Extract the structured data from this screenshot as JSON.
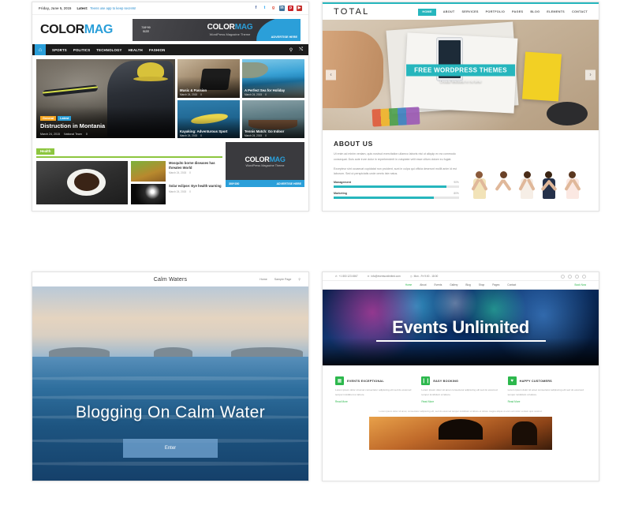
{
  "page": {
    "background": "#ffffff",
    "layout": "2x2 grid of WordPress theme preview thumbnails"
  },
  "colormag": {
    "topbar": {
      "date": "Friday, June 5, 2015",
      "latest_label": "Latest:",
      "latest_text": "Teens use app to keep secrets!",
      "social": [
        "facebook-icon",
        "twitter-icon",
        "google-plus-icon",
        "linkedin-icon",
        "pinterest-icon",
        "youtube-icon"
      ]
    },
    "logo": {
      "part1": "COLOR",
      "part2": "MAG"
    },
    "ad": {
      "size_line1": "728*90",
      "size_line2": "SIZE",
      "title1": "COLOR",
      "title2": "MAG",
      "subtitle": "WordPress Magazine Theme",
      "cta": "ADVERTISE HERE"
    },
    "nav": {
      "home_icon": "home-icon",
      "items": [
        "SPORTS",
        "POLITICS",
        "TECHNOLOGY",
        "HEALTH",
        "FASHION"
      ],
      "right_icons": [
        "search-icon",
        "random-icon"
      ]
    },
    "featured": {
      "badges": [
        "General",
        "Latest"
      ],
      "title": "Distruction in Montania",
      "date": "March 24, 2015",
      "author": "National Team",
      "comments": "0"
    },
    "grid": [
      {
        "title": "Music & Passion",
        "date": "March 24, 2015",
        "comments": "0"
      },
      {
        "title": "A Perfect Sea for Holiday",
        "date": "March 24, 2015",
        "comments": "0"
      },
      {
        "title": "Kayaking: Adventurous Sport",
        "date": "March 24, 2015",
        "comments": "0"
      },
      {
        "title": "Tennis Match: Go Indoor",
        "date": "March 24, 2015",
        "comments": "0"
      }
    ],
    "section": {
      "tag": "Health",
      "articles": [
        {
          "title": "Mosquito borne diseases has threaten World",
          "date": "March 24, 2015",
          "comments": "0"
        },
        {
          "title": "Solar eclipse: Eye health warning",
          "date": "March 24, 2015",
          "comments": "0"
        }
      ]
    },
    "sidebar_ad": {
      "title1": "COLOR",
      "title2": "MAG",
      "subtitle": "WordPress Magazine Theme",
      "size": "300*250",
      "cta": "ADVERTISE HERE"
    }
  },
  "total": {
    "logo": "TOTAL",
    "nav": [
      "HOME",
      "ABOUT",
      "SERVICES",
      "PORTFOLIO",
      "PAGES",
      "BLOG",
      "ELEMENTS",
      "CONTACT"
    ],
    "active_nav": "HOME",
    "hero": {
      "badge": "FREE WORDPRESS THEMES",
      "subtitle": "Create Website in no time",
      "prev_icon": "chevron-left-icon",
      "next_icon": "chevron-right-icon"
    },
    "about": {
      "heading": "ABOUT US",
      "paragraph1": "Ut enim ad minim veniam, quis nostrud exercitation ullamco laboris nisi ut aliquip ex ea commodo consequat. Duis aute irure dolor in reprehenderit in voluptate velit esse cillum dolore eu fugiat.",
      "paragraph2": "Excepteur sint occaecat cupidatat non proident, sunt in culpa qui officia deserunt mollit anim id est laborum. Sed ut perspiciatis unde omnis iste natus.",
      "skills": [
        {
          "name": "Management",
          "value": "90%",
          "percent": 90
        },
        {
          "name": "Marketing",
          "value": "80%",
          "percent": 80
        }
      ]
    },
    "accent": "#26b6bd"
  },
  "calmwaters": {
    "site_title": "Calm Waters",
    "nav": [
      "Home",
      "Sample Page"
    ],
    "search_icon": "search-icon",
    "hero_title": "Blogging On Calm Water",
    "button_label": "Enter"
  },
  "events": {
    "topbar": {
      "phone": "+1 800 123 4567",
      "email": "info@eventsunlimited.com",
      "hours": "Mon - Fri 9:00 - 18:00",
      "social": [
        "facebook-icon",
        "twitter-icon",
        "google-plus-icon",
        "instagram-icon"
      ]
    },
    "nav": [
      "Home",
      "About",
      "Events",
      "Gallery",
      "Blog",
      "Shop",
      "Pages",
      "Contact"
    ],
    "active_nav": "Home",
    "nav_cta": "Book Now",
    "hero_title": "Events Unlimited",
    "features": [
      {
        "icon": "calendar-icon",
        "title": "EVENTS EXCEPTIONAL",
        "text": "Lorem ipsum dolor sit amet consectetur adipiscing elit sed do eiusmod tempor incididunt ut labore.",
        "link": "Read More"
      },
      {
        "icon": "ticket-icon",
        "title": "EASY BOOKING",
        "text": "Lorem ipsum dolor sit amet consectetur adipiscing elit sed do eiusmod tempor incididunt ut labore.",
        "link": "Read More"
      },
      {
        "icon": "heart-icon",
        "title": "HAPPY CUSTOMERS",
        "text": "Lorem ipsum dolor sit amet consectetur adipiscing elit sed do eiusmod tempor incididunt ut labore.",
        "link": "Read More"
      }
    ],
    "caption": "Lorem ipsum dolor sit amet, consectetur adipiscing elit, sed do eiusmod tempor incididunt ut labore et dolore magna aliqua ut enim ad minim veniam quis nostrud.",
    "accent": "#2db84d"
  }
}
